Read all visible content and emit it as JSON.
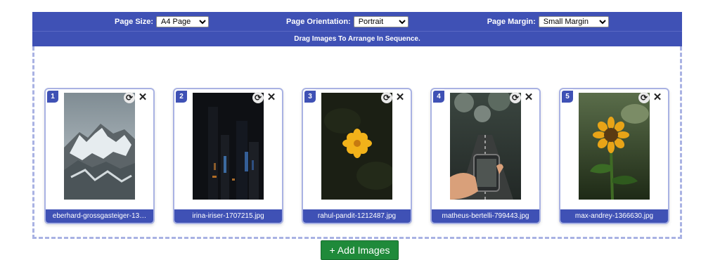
{
  "toolbar": {
    "page_size": {
      "label": "Page Size:",
      "value": "A4 Page"
    },
    "page_orientation": {
      "label": "Page Orientation:",
      "value": "Portrait"
    },
    "page_margin": {
      "label": "Page Margin:",
      "value": "Small Margin"
    }
  },
  "hint": "Drag Images To Arrange In Sequence.",
  "images": [
    {
      "index": "1",
      "filename": "eberhard-grossgasteiger-13…",
      "thumbnail": "snowy-mountain"
    },
    {
      "index": "2",
      "filename": "irina-iriser-1707215.jpg",
      "thumbnail": "night-city"
    },
    {
      "index": "3",
      "filename": "rahul-pandit-1212487.jpg",
      "thumbnail": "yellow-flower"
    },
    {
      "index": "4",
      "filename": "matheus-bertelli-799443.jpg",
      "thumbnail": "phone-road"
    },
    {
      "index": "5",
      "filename": "max-andrey-1366630.jpg",
      "thumbnail": "sunflower"
    }
  ],
  "icons": {
    "rotate": "⟳",
    "close": "✕"
  },
  "add_button": "+ Add Images",
  "colors": {
    "accent": "#3f51b5",
    "add_button": "#1f8a3a",
    "dashed_border": "#a9b2e3"
  }
}
